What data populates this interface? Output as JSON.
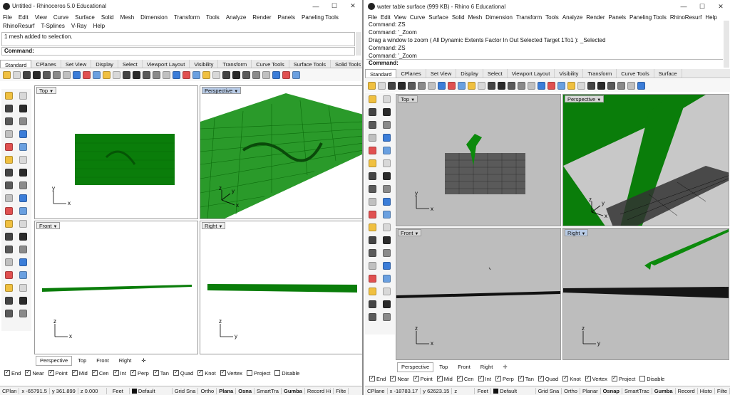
{
  "left": {
    "title": "Untitled - Rhinoceros 5.0 Educational",
    "controls": {
      "minimize": "—",
      "maximize": "☐",
      "close": "✕"
    },
    "menu": [
      "File",
      "Edit",
      "View",
      "Curve",
      "Surface",
      "Solid",
      "Mesh",
      "Dimension",
      "Transform",
      "Tools",
      "Analyze",
      "Render",
      "Panels",
      "Paneling Tools",
      "RhinoResurf",
      "T-Splines",
      "V-Ray",
      "Help"
    ],
    "history": [
      "1 mesh added to selection."
    ],
    "command_label": "Command:",
    "tabs": [
      "Standard",
      "CPlanes",
      "Set View",
      "Display",
      "Select",
      "Viewport Layout",
      "Visibility",
      "Transform",
      "Curve Tools",
      "Surface Tools",
      "Solid Tools"
    ],
    "viewports": {
      "top": "Top",
      "perspective": "Perspective",
      "front": "Front",
      "right": "Right"
    },
    "vp_tabs": [
      "Perspective",
      "Top",
      "Front",
      "Right"
    ],
    "add_tab": "✛",
    "osnap": [
      [
        "End",
        true
      ],
      [
        "Near",
        true
      ],
      [
        "Point",
        true
      ],
      [
        "Mid",
        true
      ],
      [
        "Cen",
        true
      ],
      [
        "Int",
        true
      ],
      [
        "Perp",
        true
      ],
      [
        "Tan",
        true
      ],
      [
        "Quad",
        true
      ],
      [
        "Knot",
        true
      ],
      [
        "Vertex",
        true
      ],
      [
        "Project",
        false
      ],
      [
        "Disable",
        false
      ]
    ],
    "status": {
      "cplane": "CPlan",
      "x": "x -65791.5",
      "y": "y 361.899",
      "z": "z 0.000",
      "units": "Feet",
      "layer": "Default",
      "gridsnap": "Grid Sna",
      "ortho": "Ortho",
      "planar": "Plana",
      "osnap": "Osna",
      "smarttrack": "SmartTra",
      "gumball": "Gumba",
      "record": "Record Hi",
      "filter": "Filte"
    },
    "axes": {
      "x": "x",
      "y": "y",
      "z": "z"
    }
  },
  "right": {
    "title": "water table surface (999 KB) - Rhino 6 Educational",
    "controls": {
      "minimize": "—",
      "maximize": "☐",
      "close": "✕"
    },
    "menu": [
      "File",
      "Edit",
      "View",
      "Curve",
      "Surface",
      "Solid",
      "Mesh",
      "Dimension",
      "Transform",
      "Tools",
      "Analyze",
      "Render",
      "Panels",
      "Paneling Tools",
      "RhinoResurf",
      "Help"
    ],
    "history": [
      "Command: ZS",
      "Command: '_Zoom",
      "Drag a window to zoom ( All  Dynamic  Extents  Factor  In  Out  Selected  Target  1To1 ): _Selected",
      "Command: ZS",
      "Command: '_Zoom"
    ],
    "command_label": "Command:",
    "tabs": [
      "Standard",
      "CPlanes",
      "Set View",
      "Display",
      "Select",
      "Viewport Layout",
      "Visibility",
      "Transform",
      "Curve Tools",
      "Surface"
    ],
    "viewports": {
      "top": "Top",
      "perspective": "Perspective",
      "front": "Front",
      "right": "Right"
    },
    "vp_tabs": [
      "Perspective",
      "Top",
      "Front",
      "Right"
    ],
    "add_tab": "✛",
    "osnap": [
      [
        "End",
        true
      ],
      [
        "Near",
        true
      ],
      [
        "Point",
        true
      ],
      [
        "Mid",
        true
      ],
      [
        "Cen",
        true
      ],
      [
        "Int",
        true
      ],
      [
        "Perp",
        true
      ],
      [
        "Tan",
        true
      ],
      [
        "Quad",
        true
      ],
      [
        "Knot",
        true
      ],
      [
        "Vertex",
        true
      ],
      [
        "Project",
        true
      ],
      [
        "Disable",
        false
      ]
    ],
    "status": {
      "cplane": "CPlane",
      "x": "x -18783.17",
      "y": "y 62623.15",
      "z": "z",
      "units": "Feet",
      "layer": "Default",
      "gridsnap": "Grid Sna",
      "ortho": "Ortho",
      "planar": "Planar",
      "osnap": "Osnap",
      "smarttrack": "SmartTrac",
      "gumball": "Gumba",
      "record": "Record",
      "history": "Histo",
      "filter": "Filte"
    },
    "axes": {
      "x": "x",
      "y": "y",
      "z": "z"
    }
  },
  "colors": {
    "mesh_green": "#0a7d0a",
    "mesh_dark": "#1a1a1a",
    "vp_white": "#ffffff",
    "vp_gray": "#bdbdbd",
    "active_label": "#b8cbe6"
  }
}
